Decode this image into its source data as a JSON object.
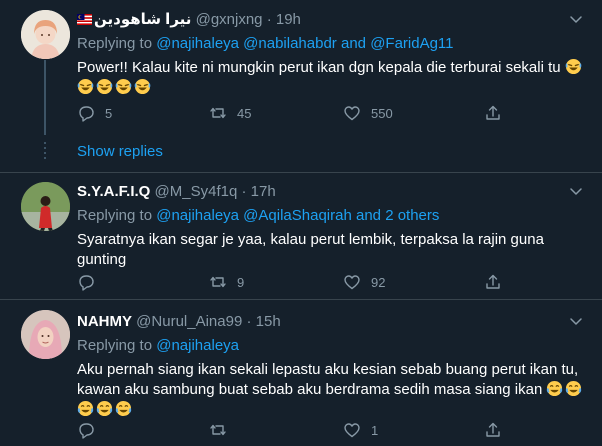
{
  "tweets": [
    {
      "name": "نيرا شاهودين",
      "handle": "@gxnjxng",
      "time": "19h",
      "replying_prefix": "Replying to",
      "mentions": [
        "@najihaleya",
        "@nabilahabdr"
      ],
      "and_text": "and",
      "mention_last": "@FaridAg11",
      "text": "Power!! Kalau kite ni mungkin perut ikan dgn kepala die terburai sekali tu",
      "replies": "5",
      "retweets": "45",
      "likes": "550",
      "show_replies": "Show replies"
    },
    {
      "name": "S.Y.A.F.I.Q",
      "handle": "@M_Sy4f1q",
      "time": "17h",
      "replying_prefix": "Replying to",
      "mentions": [
        "@najihaleya",
        "@AqilaShaqirah"
      ],
      "and_text": "and",
      "others": "2 others",
      "text": "Syaratnya ikan segar je yaa, kalau perut lembik, terpaksa la rajin guna gunting",
      "replies": "",
      "retweets": "9",
      "likes": "92"
    },
    {
      "name": "NAHMY",
      "handle": "@Nurul_Aina99",
      "time": "15h",
      "replying_prefix": "Replying to",
      "mentions": [
        "@najihaleya"
      ],
      "text": "Aku pernah siang ikan sekali lepastu aku kesian sebab buang perut ikan tu, kawan aku sambung buat sebab aku berdrama sedih masa siang ikan",
      "replies": "",
      "retweets": "",
      "likes": "1"
    }
  ],
  "colors": {
    "background": "#15202b",
    "accent": "#1da1f2",
    "muted": "#8899a6",
    "divider": "#38444d"
  },
  "icons": [
    "reply-icon",
    "retweet-icon",
    "like-icon",
    "share-icon",
    "chevron-down-icon",
    "rofl-emoji",
    "joy-emoji",
    "malaysia-flag"
  ]
}
